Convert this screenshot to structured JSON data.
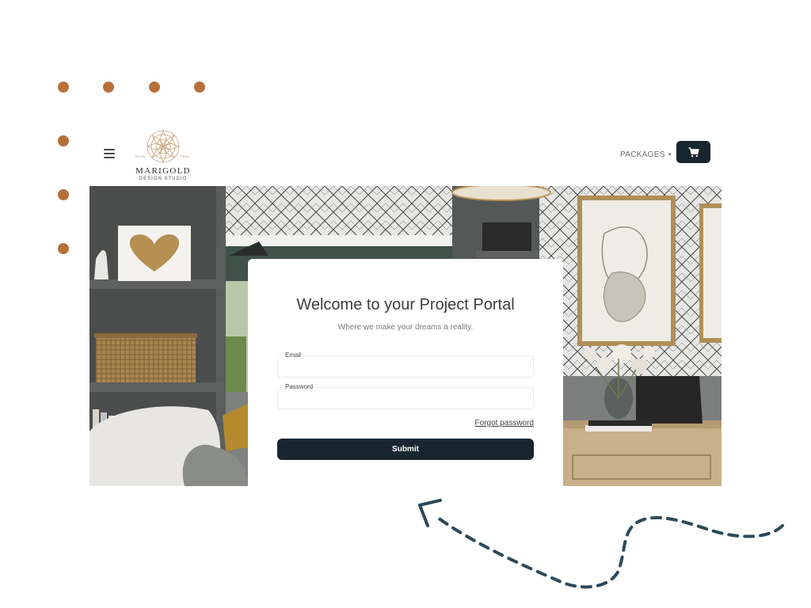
{
  "colors": {
    "accent_dot": "#b8703a",
    "primary_dark": "#18262f",
    "arrow": "#2c4a5a"
  },
  "header": {
    "logo": {
      "name": "MARIGOLD",
      "tagline": "DESIGN STUDIO",
      "estd_label": "ESTD.",
      "year": "2014"
    },
    "nav": {
      "packages_label": "PACKAGES"
    },
    "menu_icon": "hamburger-menu-icon",
    "cart_icon": "cart-icon"
  },
  "login": {
    "title": "Welcome to your Project Portal",
    "subtitle": "Where we make your dreams a reality.",
    "email": {
      "label": "Email",
      "value": ""
    },
    "password": {
      "label": "Password",
      "value": ""
    },
    "forgot_label": "Forgot password",
    "submit_label": "Submit"
  }
}
